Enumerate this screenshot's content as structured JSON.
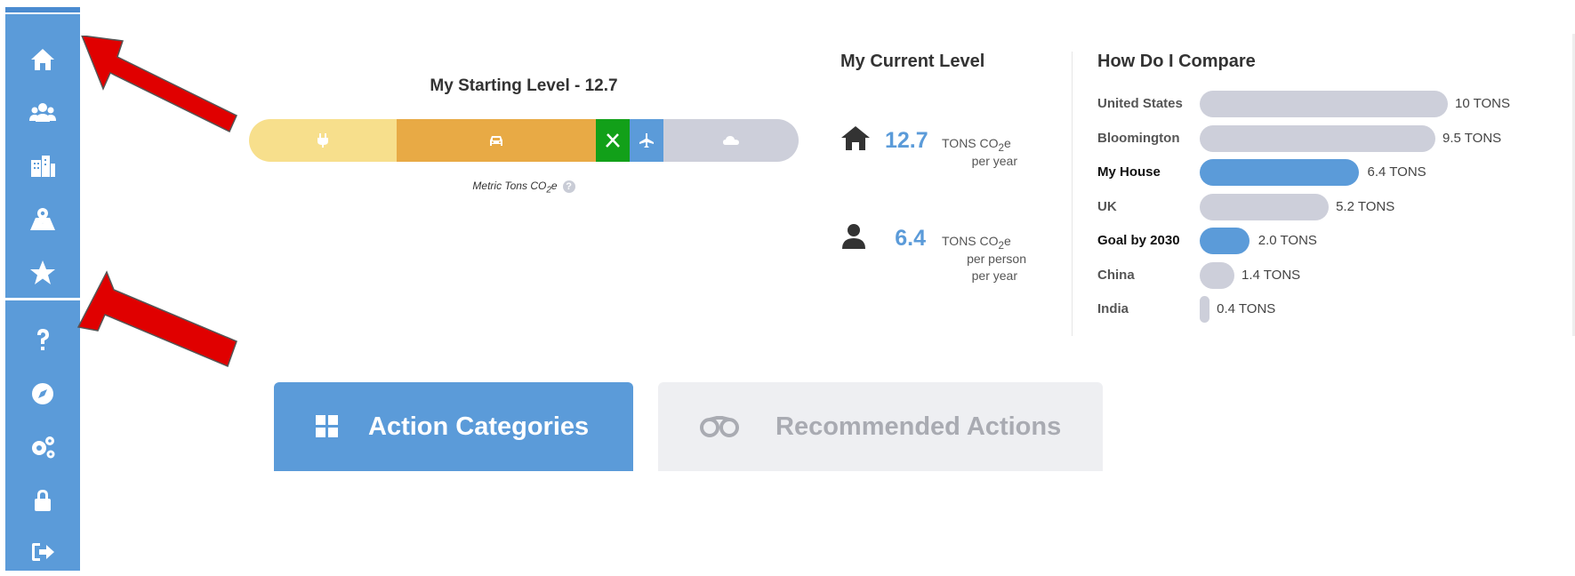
{
  "sidebar": {
    "items": [
      {
        "icon": "home-icon"
      },
      {
        "icon": "users-icon"
      },
      {
        "icon": "buildings-icon"
      },
      {
        "icon": "map-marker-icon"
      },
      {
        "icon": "star-icon"
      },
      {
        "icon": "question-icon"
      },
      {
        "icon": "compass-icon"
      },
      {
        "icon": "gears-icon"
      },
      {
        "icon": "lock-icon"
      },
      {
        "icon": "sign-out-icon"
      }
    ]
  },
  "starting_level": {
    "title": "My Starting Level - 12.7",
    "segments": [
      {
        "icon": "plug-icon",
        "color": "#f7df8c"
      },
      {
        "icon": "car-icon",
        "color": "#e8aa45"
      },
      {
        "icon": "utensils-icon",
        "color": "#12a019"
      },
      {
        "icon": "plane-icon",
        "color": "#5b9bd9"
      },
      {
        "icon": "cloud-icon",
        "color": "#cdcfda"
      }
    ],
    "metric_label": "Metric Tons CO",
    "metric_sub": "2",
    "metric_suffix": "e",
    "help": "?"
  },
  "current_level": {
    "title": "My Current Level",
    "house": {
      "icon": "home-icon",
      "value": "12.7",
      "unit": "TONS CO",
      "unit_sub": "2",
      "unit_suffix": "e",
      "line2": "per year"
    },
    "person": {
      "icon": "user-icon",
      "value": "6.4",
      "unit": "TONS CO",
      "unit_sub": "2",
      "unit_suffix": "e",
      "line2": "per person",
      "line3": "per year"
    }
  },
  "compare": {
    "title": "How Do I Compare",
    "rows": [
      {
        "label": "United States",
        "value": 10,
        "display": "10 TONS",
        "highlight": false
      },
      {
        "label": "Bloomington",
        "value": 9.5,
        "display": "9.5 TONS",
        "highlight": false
      },
      {
        "label": "My House",
        "value": 6.4,
        "display": "6.4 TONS",
        "highlight": true
      },
      {
        "label": "UK",
        "value": 5.2,
        "display": "5.2 TONS",
        "highlight": false
      },
      {
        "label": "Goal by 2030",
        "value": 2.0,
        "display": "2.0 TONS",
        "highlight": true
      },
      {
        "label": "China",
        "value": 1.4,
        "display": "1.4 TONS",
        "highlight": false
      },
      {
        "label": "India",
        "value": 0.4,
        "display": "0.4 TONS",
        "highlight": false
      }
    ],
    "colors": {
      "highlight": "#5b9bd9",
      "default": "#cdcfda"
    }
  },
  "tabs": [
    {
      "label": "Action Categories",
      "icon": "grid-icon",
      "active": true
    },
    {
      "label": "Recommended Actions",
      "icon": "binoculars-icon",
      "active": false
    }
  ],
  "colors": {
    "accent": "#5b9bd9",
    "annotation_arrow": "#e00000"
  }
}
